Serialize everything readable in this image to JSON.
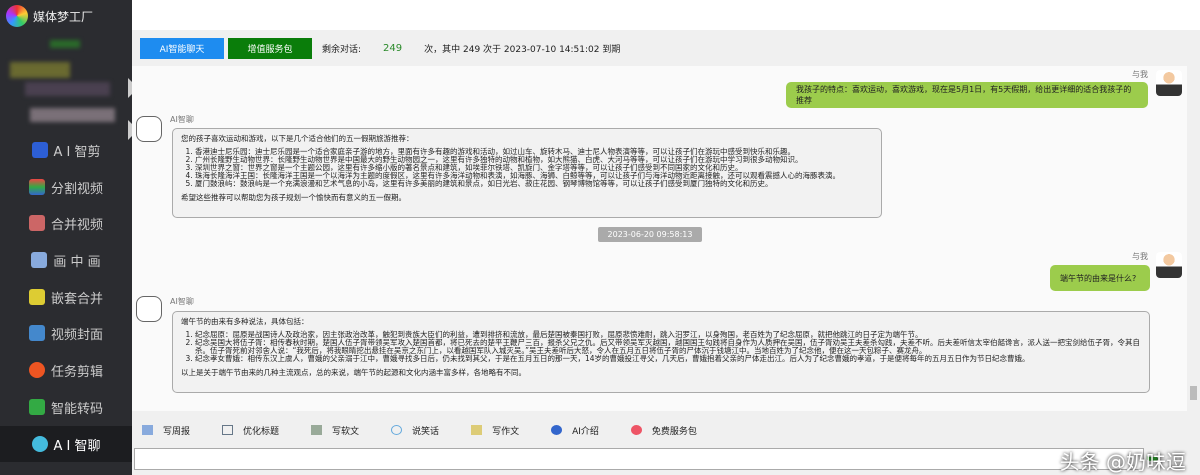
{
  "app": {
    "title": "媒体梦工厂"
  },
  "sidebar": {
    "items": [
      {
        "label": "A I 智剪",
        "icon": "ai-cut-icon",
        "color": "#2d5fd6"
      },
      {
        "label": "分割视频",
        "icon": "split-video-icon",
        "color": "#e44"
      },
      {
        "label": "合并视频",
        "icon": "merge-video-icon",
        "color": "#c66"
      },
      {
        "label": "画 中 画",
        "icon": "picture-in-picture-icon",
        "color": "#8ad"
      },
      {
        "label": "嵌套合并",
        "icon": "nested-merge-icon",
        "color": "#dc3"
      },
      {
        "label": "视频封面",
        "icon": "video-cover-icon",
        "color": "#48c"
      },
      {
        "label": "任务剪辑",
        "icon": "task-edit-icon",
        "color": "#e52"
      },
      {
        "label": "智能转码",
        "icon": "smart-transcode-icon",
        "color": "#3a4"
      },
      {
        "label": "A I 智聊",
        "icon": "ai-chat-icon",
        "color": "#4bd"
      }
    ]
  },
  "header": {
    "ai_chat_btn": "AI智能聊天",
    "addon_btn": "增值服务包",
    "remaining_label": "剩余对话:",
    "remaining_count": "249",
    "remaining_detail": "次，其中 249 次于 2023-07-10 14:51:02 到期"
  },
  "colors": {
    "ai_btn": "#1e8cf0",
    "addon_btn": "#0a7d0a",
    "user_bubble": "#9ccc4c"
  },
  "chat": {
    "messages": [
      {
        "sender": "与我",
        "text": "我孩子的特点：喜欢运动，喜欢游戏，现在是5月1日，有5天假期，给出更详细的适合我孩子的推荐"
      },
      {
        "sender": "AI智聊",
        "intro": "您的孩子喜欢运动和游戏，以下是几个适合他们的五一假期旅游推荐：",
        "items": [
          "香港迪士尼乐园：迪士尼乐园是一个适合家庭亲子游的地方，里面有许多有趣的游戏和活动，如过山车、旋转木马、迪士尼人物表演等等，可以让孩子们在游玩中感受到快乐和乐趣。",
          "广州长隆野生动物世界：长隆野生动物世界是中国最大的野生动物园之一，这里有许多独特的动物和植物，如大熊猫、白虎、大河马等等，可以让孩子们在游玩中学习到很多动物知识。",
          "深圳世界之窗：世界之窗是一个主题公园，这里有许多缩小版的著名景点和建筑，如埃菲尔铁塔、凯旋门、金字塔等等，可以让孩子们感受到不同国家的文化和历史。",
          "珠海长隆海洋王国：长隆海洋王国是一个以海洋为主题的度假区，这里有许多海洋动物和表演，如海豚、海狮、白鲸等等，可以让孩子们与海洋动物近距离接触，还可以观看震撼人心的海豚表演。",
          "厦门鼓浪屿：鼓浪屿是一个充满浪漫和艺术气息的小岛，这里有许多美丽的建筑和景点，如日光岩、菽庄花园、钢琴博物馆等等，可以让孩子们感受到厦门独特的文化和历史。"
        ],
        "outro": "希望这些推荐可以帮助您为孩子规划一个愉快而有意义的五一假期。"
      },
      {
        "timestamp": "2023-06-20 09:58:13"
      },
      {
        "sender": "与我",
        "text": "端午节的由来是什么?"
      },
      {
        "sender": "AI智聊",
        "intro": "端午节的由来有多种说法，具体包括：",
        "items": [
          "纪念屈原：屈原是战国诗人及政治家，因主张政治改革，触犯到贵族大臣们的利益，遭到排挤和流放，最后楚国被秦国打败，屈原悲愤难耐，跳入汨罗江，以身殉国，老百姓为了纪念屈原，就把他跳江的日子定为端午节。",
          "纪念吴国大将伍子胥：相传春秋时期，楚国人伍子胥带领吴军攻入楚国首都，将已死去的楚平王鞭尸三百，报杀父兄之仇。后又带领吴军灭越国，越国国王勾践将自身作为人质押在吴国，伍子胥劝吴王夫差杀勾践，夫差不听。后夫差听信太宰伯嚭谗言，派人送一把宝剑给伍子胥，令其自杀。伍子胥死前对邻舍人说：“我死后，将我眼睛挖出悬挂在吴京之东门上，以看越国军队入城灭吴。”吴王夫差听后大怒，令人在五月五日将伍子胥的尸体沉于钱塘江中。当地百姓为了纪念他，便在这一天包粽子、赛龙舟。",
          "纪念孝女曹娥：相传东汉上虞人，曹娥的父亲溺于江中，曹娥寻找多日后，仍未找到其父，于是在五月五日的那一天，14岁的曹娥投江寻父，几天后，曹娥抱着父亲的尸体走出江。后人为了纪念曹娥的孝道，于是便将每年的五月五日作为节日纪念曹娥。"
        ],
        "outro": "以上是关于端午节由来的几种主流观点，总的来说，端午节的起源和文化内涵丰富多样，各地略有不同。"
      }
    ]
  },
  "toolbar": {
    "items": [
      "写周报",
      "优化标题",
      "写软文",
      "说笑话",
      "写作文",
      "AI介绍",
      "免费服务包"
    ]
  },
  "watermark": "头条 @奶味逗"
}
